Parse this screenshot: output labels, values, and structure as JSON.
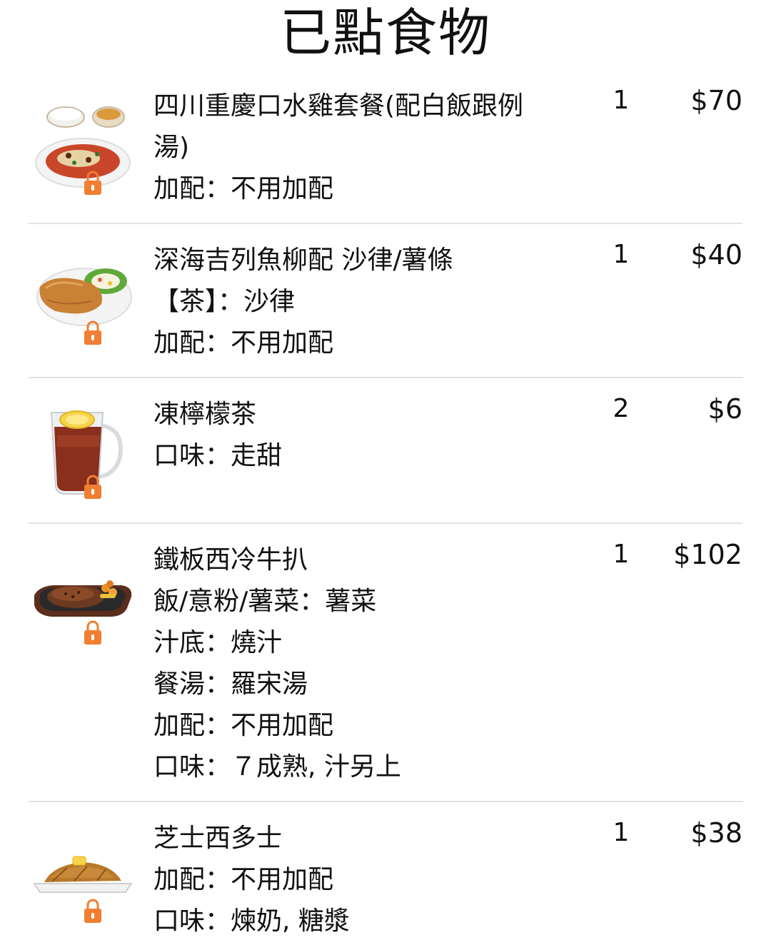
{
  "header": {
    "title": "已點食物"
  },
  "colors": {
    "lock": "#f07f32",
    "divider": "#e2e2e2",
    "text": "#111111"
  },
  "items": [
    {
      "name": "四川重慶口水雞套餐(配白飯跟例湯)",
      "options": [
        "加配：不用加配"
      ],
      "quantity": "1",
      "price": "$70",
      "image_icon": "saliva-chicken-set-icon",
      "locked": true
    },
    {
      "name": "深海吉列魚柳配 沙律/薯條",
      "options": [
        "【茶】：沙律",
        "加配：不用加配"
      ],
      "quantity": "1",
      "price": "$40",
      "image_icon": "fish-fillet-icon",
      "locked": true
    },
    {
      "name": "凍檸檬茶",
      "options": [
        "口味：走甜"
      ],
      "quantity": "2",
      "price": "$6",
      "image_icon": "iced-lemon-tea-icon",
      "locked": true
    },
    {
      "name": "鐵板西冷牛扒",
      "options": [
        "飯/意粉/薯菜：薯菜",
        "汁底：燒汁",
        "餐湯：羅宋湯",
        "加配：不用加配",
        "口味：７成熟, 汁另上"
      ],
      "quantity": "1",
      "price": "$102",
      "image_icon": "sizzling-steak-icon",
      "locked": true
    },
    {
      "name": "芝士西多士",
      "options": [
        "加配：不用加配",
        "口味：煉奶, 糖漿"
      ],
      "quantity": "1",
      "price": "$38",
      "image_icon": "french-toast-icon",
      "locked": true
    }
  ]
}
